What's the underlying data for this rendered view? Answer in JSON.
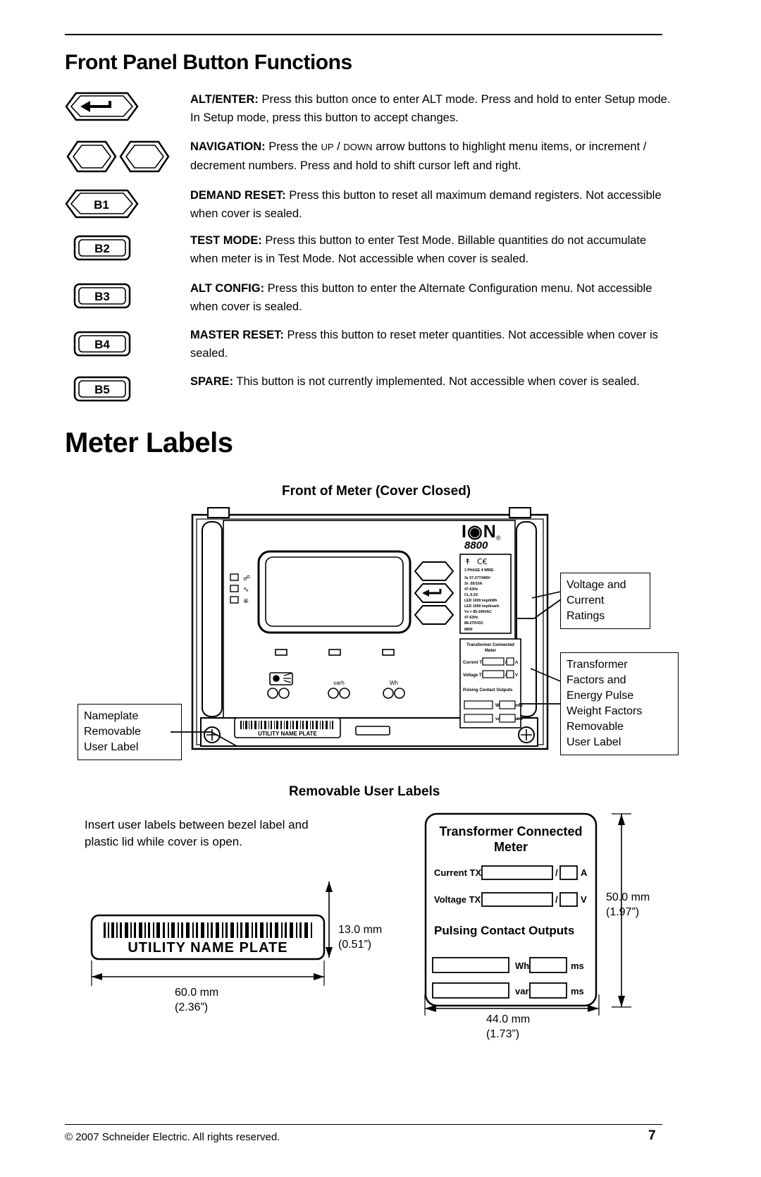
{
  "headings": {
    "front_panel": "Front Panel Button Functions",
    "meter_labels": "Meter Labels",
    "front_of_meter": "Front of Meter (Cover Closed)",
    "removable_user_labels": "Removable User Labels"
  },
  "buttons": [
    {
      "icon": "alt-enter-arrow-button",
      "label": "ALT/ENTER:",
      "text": " Press this button once to enter ALT mode. Press and hold to enter Setup mode. In Setup mode, press this button to accept changes."
    },
    {
      "icon": "navigation-arrow-buttons",
      "label": "NAVIGATION:",
      "text_pre": " Press the ",
      "mono1": "UP",
      "mid": " / ",
      "mono2": "DOWN",
      "text_post": " arrow buttons to highlight menu items, or increment / decrement numbers. Press and hold to shift cursor left and right."
    },
    {
      "icon": "b1-button",
      "key": "B1",
      "label": "DEMAND RESET:",
      "text": " Press this button to reset all maximum demand registers. Not accessible when cover is sealed."
    },
    {
      "icon": "b2-button",
      "key": "B2",
      "label": "TEST MODE:",
      "text": " Press this button to enter Test Mode. Billable quantities do not accumulate when meter is in Test Mode. Not accessible when cover is sealed."
    },
    {
      "icon": "b3-button",
      "key": "B3",
      "label": "ALT CONFIG:",
      "text": " Press this button to enter the Alternate Configuration menu. Not accessible when cover is sealed."
    },
    {
      "icon": "b4-button",
      "key": "B4",
      "label": "MASTER RESET:",
      "text": " Press this button to reset meter quantities. Not accessible when cover is sealed."
    },
    {
      "icon": "b5-button",
      "key": "B5",
      "label": "SPARE:",
      "text": " This button is not currently implemented. Not accessible when cover is sealed."
    }
  ],
  "meter": {
    "brand": "ION",
    "model": "8800",
    "ratings_block": [
      "3 PHASE 4 WIRE",
      "3x  57-277/480V",
      "3x  .05/10A",
      "47-63Hz",
      "CL.0.2S",
      "LED 1000 imp/kWh",
      "LED 1000 imp/kvarh",
      "Vs = 85-240VAC",
      "47-63Hz",
      "88-270VDC",
      "8800"
    ],
    "transformer_block": {
      "title_line1": "Transformer Connected",
      "title_line2": "Meter",
      "current_tx": "Current TX",
      "voltage_tx": "Voltage TX",
      "unit_a": "A",
      "unit_v": "V",
      "slash": "/",
      "pulsing_title": "Pulsing Contact Outputs",
      "wh_pulse": "Wh / pulse",
      "varh_pulse": "varh / pulse",
      "ms": "ms"
    },
    "nameplate_text": "UTILITY NAME PLATE",
    "led_labels": [
      "varh",
      "Wh"
    ]
  },
  "callouts": {
    "voltage_current": "Voltage and\nCurrent\nRatings",
    "voltage_current_lines": [
      "Voltage and",
      "Current",
      "Ratings"
    ],
    "transformer_lines": [
      "Transformer",
      "Factors and",
      "Energy Pulse",
      "Weight Factors",
      "Removable",
      "User Label"
    ],
    "nameplate_lines": [
      "Nameplate",
      "Removable",
      "User Label"
    ]
  },
  "removable": {
    "note": "Insert user labels between bezel label and plastic lid while cover is open.",
    "nameplate_text": "UTILITY NAME PLATE",
    "nameplate_height_mm": "13.0 mm",
    "nameplate_height_in": "(0.51”)",
    "nameplate_width_mm": "60.0 mm",
    "nameplate_width_in": "(2.36”)",
    "transformer_height_mm": "50.0 mm",
    "transformer_height_in": "(1.97”)",
    "transformer_width_mm": "44.0 mm",
    "transformer_width_in": "(1.73”)",
    "label": {
      "title_line1": "Transformer Connected",
      "title_line2": "Meter",
      "current_tx": "Current TX",
      "voltage_tx": "Voltage TX",
      "unit_a": "A",
      "unit_v": "V",
      "slash": "/",
      "pulsing_title": "Pulsing Contact Outputs",
      "wh_pulse": "Wh / pulse",
      "varh_pulse": "varh / pulse",
      "ms": "ms"
    }
  },
  "footer": {
    "copyright": "© 2007 Schneider Electric.  All rights reserved.",
    "page_number": "7"
  }
}
